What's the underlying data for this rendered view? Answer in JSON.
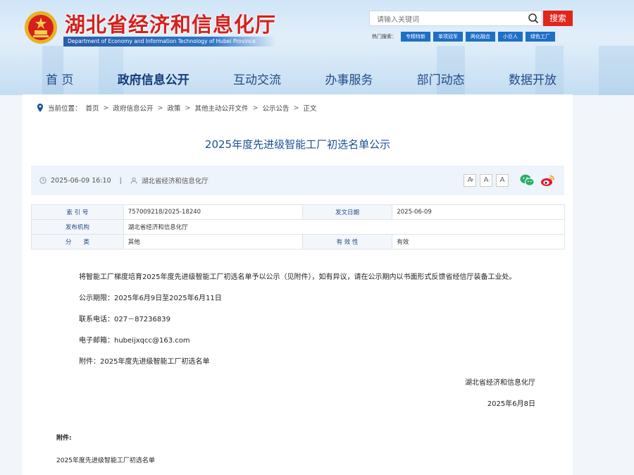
{
  "header": {
    "site_title": "湖北省经济和信息化厅",
    "site_subtitle": "Department of Economy and Information Technology of Hubei Province",
    "search": {
      "placeholder": "请输入关键词",
      "button": "搜索"
    },
    "hot_search": {
      "label": "热门搜索：",
      "tags": [
        "专精特新",
        "单项冠军",
        "两化融合",
        "小巨人",
        "绿色工厂"
      ]
    }
  },
  "nav": [
    "首 页",
    "政府信息公开",
    "互动交流",
    "办事服务",
    "部门动态",
    "数据开放"
  ],
  "breadcrumb": {
    "label": "当前位置：",
    "items": [
      "首页",
      "政府信息公开",
      "政策",
      "其他主动公开文件",
      "公示公告",
      "正文"
    ]
  },
  "article": {
    "title": "2025年度先进级智能工厂初选名单公示",
    "date": "2025-06-09 16:10",
    "source": "湖北省经济和信息化厅",
    "font_sizes": [
      "A",
      "A",
      "A"
    ]
  },
  "info_table": [
    [
      "索 引 号",
      "757009218/2025-18240",
      "发文日期",
      "2025-06-09"
    ],
    [
      "发布机构",
      "湖北省经济和信息化厅",
      "",
      ""
    ],
    [
      "分　　类",
      "其他",
      "有 效 性",
      "有效"
    ]
  ],
  "body": {
    "intro": "将智能工厂梯度培育2025年度先进级智能工厂初选名单予以公示（见附件），如有异议，请在公示期内以书面形式反馈省经信厅装备工业处。",
    "period": "公示期限：2025年6月9日至2025年6月11日",
    "phone": "联系电话：027－87236839",
    "email": "电子邮箱：hubeijxqcc@163.com",
    "attachment": "附件：2025年度先进级智能工厂初选名单",
    "signature": "湖北省经济和信息化厅",
    "sign_date": "2025年6月8日",
    "attach_heading": "附件:",
    "attach_link": "2025年度先进级智能工厂初选名单"
  },
  "colors": {
    "accent_red": "#e1251b",
    "nav_blue": "#1f4a8a",
    "title_blue": "#1a4f97"
  }
}
